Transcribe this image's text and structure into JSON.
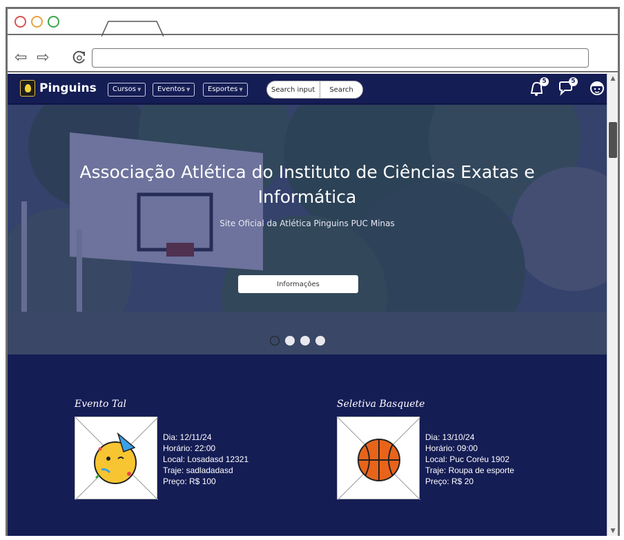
{
  "site": {
    "logo_text": "Pinguins",
    "menus": [
      {
        "label": "Cursos"
      },
      {
        "label": "Eventos"
      },
      {
        "label": "Esportes"
      }
    ],
    "search": {
      "placeholder": "Search input",
      "button_label": "Search"
    },
    "notifications": {
      "count": "5"
    },
    "messages": {
      "count": "5"
    }
  },
  "hero": {
    "title": "Associação Atlética do Instituto de Ciências Exatas  e Informática",
    "subtitle": "Site Oficial da Atlética Pinguins PUC Minas",
    "button_label": "Informações",
    "carousel_slides": 4,
    "active_slide": 1
  },
  "events": [
    {
      "title": "Evento Tal",
      "icon": "party-face-icon",
      "details": [
        "Dia: 12/11/24",
        "Horário: 22:00",
        "Local: Losadasd 12321",
        "Traje: sadladadasd",
        "Preço: R$ 100"
      ]
    },
    {
      "title": "Seletiva Basquete",
      "icon": "basketball-icon",
      "details": [
        "Dia: 13/10/24",
        "Horário: 09:00",
        "Local: Puc Coréu 1902",
        "Traje: Roupa de esporte",
        "Preço: R$ 20"
      ]
    }
  ],
  "colors": {
    "primary": "#151d55",
    "overlay": "#212a6e",
    "accent": "#ffffff"
  }
}
